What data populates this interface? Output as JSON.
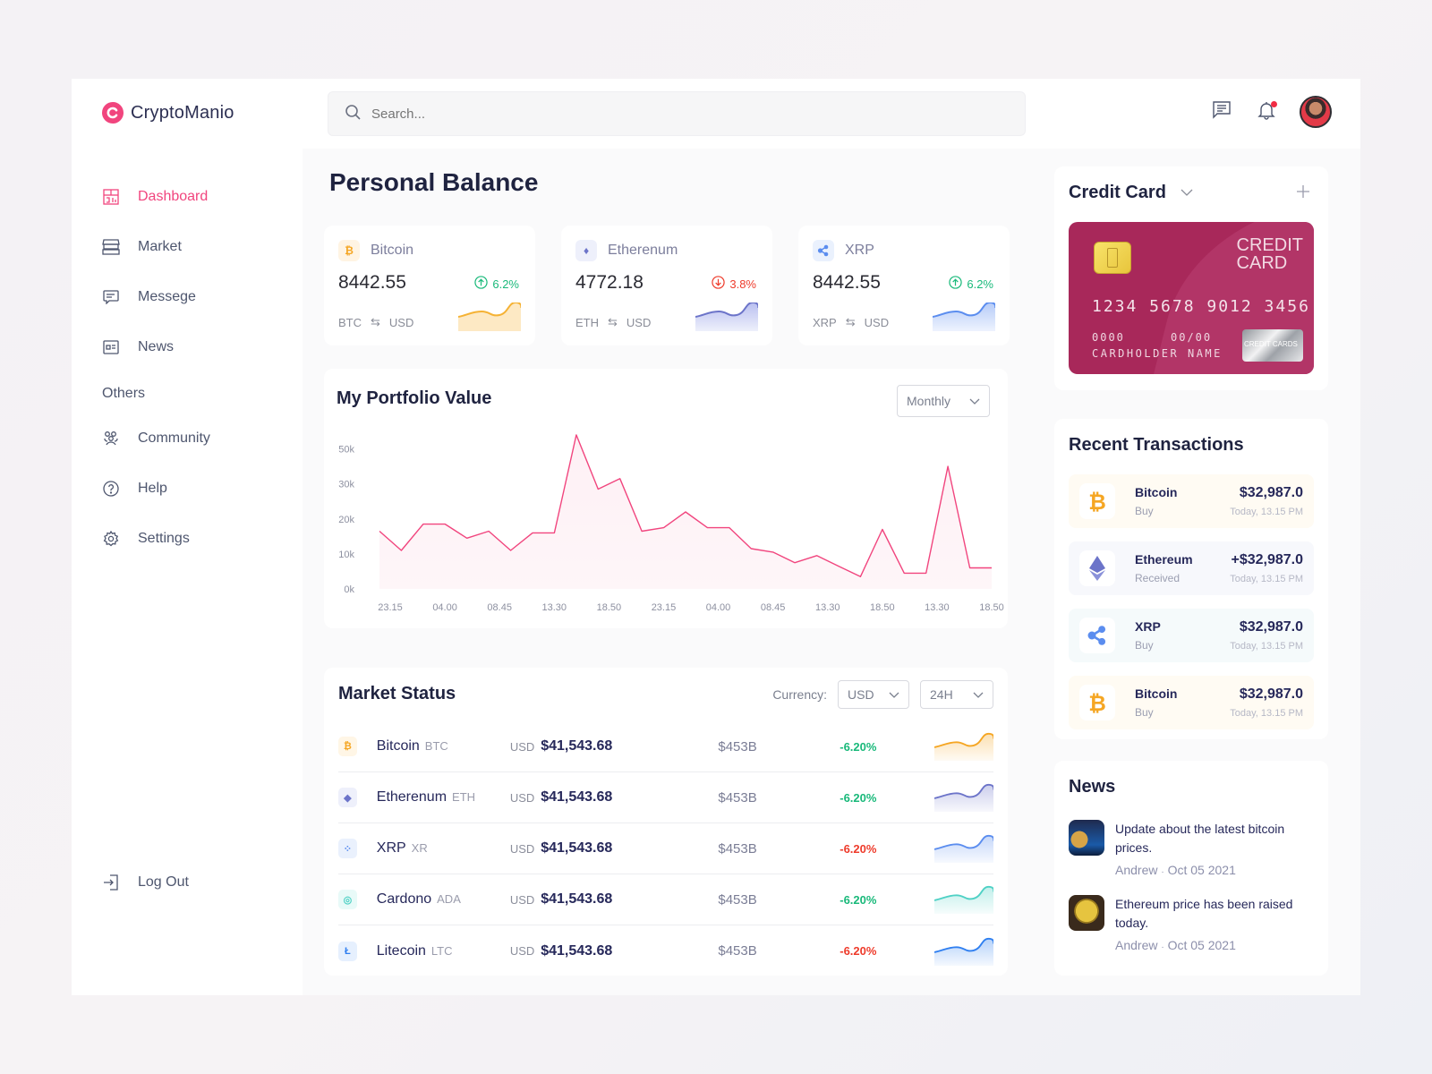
{
  "brand": {
    "name": "CryptoManio",
    "accent": "#f1457e"
  },
  "search": {
    "placeholder": "Search..."
  },
  "topbar": {
    "messages_icon": "chat-icon",
    "notifications_icon": "bell-icon",
    "has_notification": true
  },
  "sidebar": {
    "items": [
      {
        "label": "Dashboard",
        "icon": "dashboard-icon",
        "active": true
      },
      {
        "label": "Market",
        "icon": "market-icon"
      },
      {
        "label": "Messege",
        "icon": "message-icon"
      },
      {
        "label": "News",
        "icon": "news-icon"
      }
    ],
    "section_label": "Others",
    "others": [
      {
        "label": "Community",
        "icon": "community-icon"
      },
      {
        "label": "Help",
        "icon": "help-icon"
      },
      {
        "label": "Settings",
        "icon": "settings-icon"
      }
    ],
    "logout_label": "Log Out"
  },
  "balance": {
    "title": "Personal Balance",
    "cards": [
      {
        "name": "Bitcoin",
        "value": "8442.55",
        "change": "6.2%",
        "direction": "up",
        "base": "BTC",
        "quote": "USD",
        "color": "#f5a623"
      },
      {
        "name": "Etherenum",
        "value": "4772.18",
        "change": "3.8%",
        "direction": "down",
        "base": "ETH",
        "quote": "USD",
        "color": "#6c74c9"
      },
      {
        "name": "XRP",
        "value": "8442.55",
        "change": "6.2%",
        "direction": "up",
        "base": "XRP",
        "quote": "USD",
        "color": "#5b8def"
      }
    ]
  },
  "portfolio": {
    "title": "My Portfolio Value",
    "period": "Monthly"
  },
  "chart_data": {
    "type": "area",
    "title": "My Portfolio Value",
    "xlabel": "",
    "ylabel": "",
    "y_ticks": [
      "0k",
      "10k",
      "20k",
      "30k",
      "50k"
    ],
    "y_tick_values": [
      0,
      10,
      20,
      30,
      40
    ],
    "x_ticks": [
      "23.15",
      "04.00",
      "08.45",
      "13.30",
      "18.50",
      "23.15",
      "04.00",
      "08.45",
      "13.30",
      "18.50",
      "13.30",
      "18.50"
    ],
    "ylim": [
      0,
      45
    ],
    "series": [
      {
        "name": "Portfolio",
        "color": "#f1457e",
        "values": [
          16.5,
          11,
          18.5,
          18.5,
          14.5,
          16.5,
          11,
          16,
          16,
          44,
          28.5,
          31.5,
          16.5,
          17.5,
          22,
          17.5,
          17.5,
          11.5,
          10.5,
          7.5,
          9.5,
          6.5,
          3.5,
          17,
          4.5,
          4.5,
          35,
          6,
          6
        ]
      }
    ],
    "grid": false,
    "legend": "none"
  },
  "market": {
    "title": "Market Status",
    "currency_label": "Currency:",
    "currency": "USD",
    "range": "24H",
    "rows": [
      {
        "name": "Bitcoin",
        "symbol": "BTC",
        "currency": "USD",
        "price": "$41,543.68",
        "cap": "$453B",
        "change": "-6.20%",
        "change_color": "#19b97a",
        "color": "#f5a623",
        "bg": "#fff6e6",
        "glyph": "₿"
      },
      {
        "name": "Etherenum",
        "symbol": "ETH",
        "currency": "USD",
        "price": "$41,543.68",
        "cap": "$453B",
        "change": "-6.20%",
        "change_color": "#19b97a",
        "color": "#6c74c9",
        "bg": "#eef0fb",
        "glyph": "◆"
      },
      {
        "name": "XRP",
        "symbol": "XR",
        "currency": "USD",
        "price": "$41,543.68",
        "cap": "$453B",
        "change": "-6.20%",
        "change_color": "#ee3b2b",
        "color": "#5b8def",
        "bg": "#eaf1fd",
        "glyph": "⁘"
      },
      {
        "name": "Cardono",
        "symbol": "ADA",
        "currency": "USD",
        "price": "$41,543.68",
        "cap": "$453B",
        "change": "-6.20%",
        "change_color": "#19b97a",
        "color": "#4fd1c5",
        "bg": "#e8faf8",
        "glyph": "◎"
      },
      {
        "name": "Litecoin",
        "symbol": "LTC",
        "currency": "USD",
        "price": "$41,543.68",
        "cap": "$453B",
        "change": "-6.20%",
        "change_color": "#ee3b2b",
        "color": "#2f7ff0",
        "bg": "#e6f0fe",
        "glyph": "Ł"
      }
    ]
  },
  "credit_card": {
    "title": "Credit Card",
    "label_line1": "CREDIT",
    "label_line2": "CARD",
    "number": "1234 5678 9012 3456",
    "cvv": "0000",
    "expiry": "00/00",
    "holder": "CARDHOLDER NAME",
    "hologram": "CREDIT CARDS"
  },
  "transactions": {
    "title": "Recent Transactions",
    "items": [
      {
        "name": "Bitcoin",
        "type": "Buy",
        "amount": "$32,987.0",
        "time": "Today, 13.15 PM",
        "bg": "#fffbf3"
      },
      {
        "name": "Ethereum",
        "type": "Received",
        "amount": "+$32,987.0",
        "time": "Today, 13.15 PM",
        "bg": "#f7f8fc"
      },
      {
        "name": "XRP",
        "type": "Buy",
        "amount": "$32,987.0",
        "time": "Today, 13.15 PM",
        "bg": "#f5fafb"
      },
      {
        "name": "Bitcoin",
        "type": "Buy",
        "amount": "$32,987.0",
        "time": "Today, 13.15 PM",
        "bg": "#fffbf3"
      }
    ]
  },
  "news": {
    "title": "News",
    "items": [
      {
        "title": "Update about the latest bitcoin prices.",
        "author": "Andrew",
        "date": "Oct 05 2021"
      },
      {
        "title": "Ethereum price has been raised today.",
        "author": "Andrew",
        "date": "Oct 05 2021"
      }
    ]
  }
}
